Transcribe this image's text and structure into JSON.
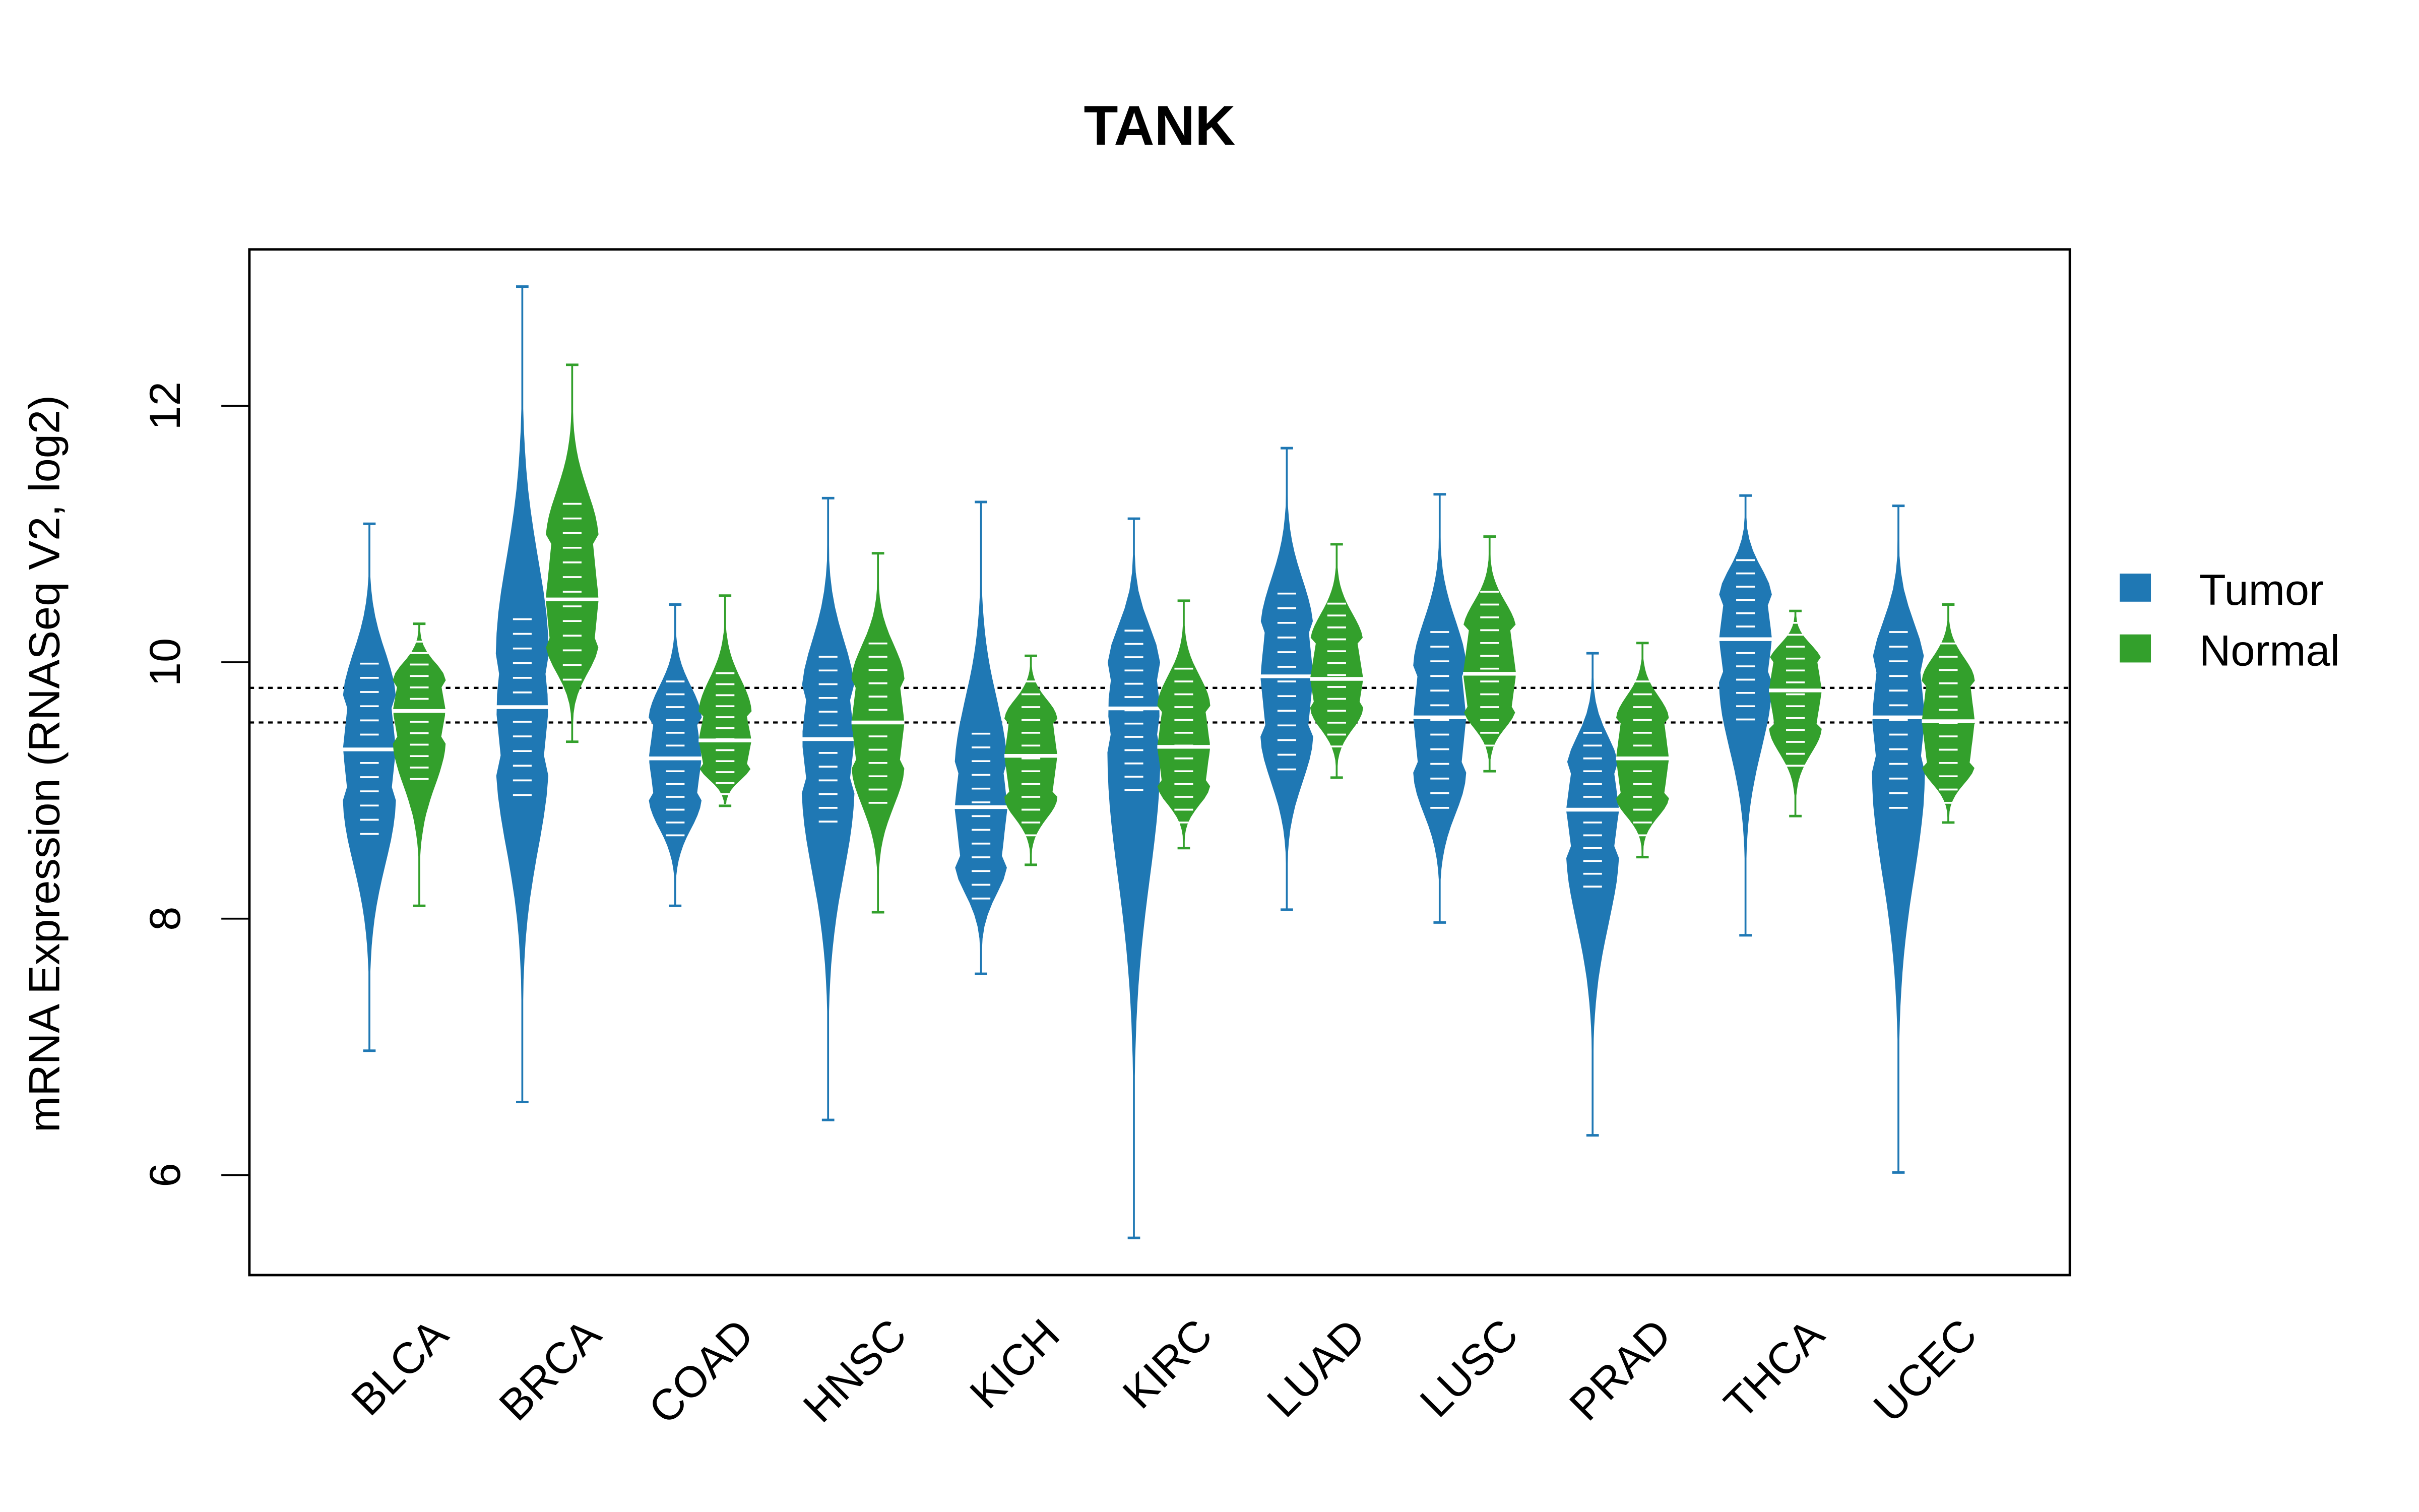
{
  "chart_data": {
    "type": "violin",
    "title": "TANK",
    "xlabel": "",
    "ylabel": "mRNA Expression (RNASeq V2, log2)",
    "ylim": [
      5.22,
      13.22
    ],
    "yticks": [
      6,
      8,
      10,
      12
    ],
    "ytick_labels": [
      "6",
      "8",
      "10",
      "12"
    ],
    "categories": [
      "BLCA",
      "BRCA",
      "COAD",
      "HNSC",
      "KICH",
      "KIRC",
      "LUAD",
      "LUSC",
      "PRAD",
      "THCA",
      "UCEC"
    ],
    "reference_lines": [
      {
        "y": 9.8,
        "style": "dotted"
      },
      {
        "y": 9.53,
        "style": "dotted"
      }
    ],
    "legend": {
      "placement": "right",
      "entries": [
        {
          "label": "Tumor",
          "color": "#1F78B4"
        },
        {
          "label": "Normal",
          "color": "#33A02C"
        }
      ]
    },
    "series": [
      {
        "name": "Tumor",
        "color": "#1F78B4",
        "median": [
          9.32,
          9.65,
          9.25,
          9.4,
          8.87,
          9.64,
          9.89,
          9.57,
          8.85,
          10.18,
          9.57
        ],
        "q1": [
          8.95,
          9.25,
          8.95,
          9.05,
          8.45,
          9.3,
          9.45,
          9.15,
          8.55,
          9.85,
          9.15
        ],
        "q3": [
          9.7,
          10.05,
          9.55,
          9.75,
          9.15,
          9.95,
          10.25,
          9.95,
          9.15,
          10.5,
          9.95
        ],
        "min": [
          6.97,
          6.57,
          8.1,
          6.43,
          7.57,
          5.51,
          8.07,
          7.97,
          6.31,
          7.87,
          6.02
        ],
        "max": [
          11.08,
          12.93,
          10.45,
          11.28,
          11.25,
          11.12,
          11.67,
          11.31,
          10.07,
          11.3,
          11.22
        ]
      },
      {
        "name": "Normal",
        "color": "#33A02C",
        "median": [
          9.62,
          10.49,
          9.39,
          9.53,
          9.27,
          9.34,
          9.87,
          9.91,
          9.25,
          9.78,
          9.54
        ],
        "q1": [
          9.4,
          10.15,
          9.2,
          9.2,
          8.95,
          9.05,
          9.65,
          9.65,
          8.95,
          9.5,
          9.2
        ],
        "q3": [
          9.85,
          10.95,
          9.6,
          9.85,
          9.55,
          9.65,
          10.15,
          10.25,
          9.55,
          10.0,
          9.85
        ],
        "min": [
          8.1,
          9.38,
          8.88,
          8.05,
          8.42,
          8.55,
          9.1,
          9.15,
          8.48,
          8.8,
          8.75
        ],
        "max": [
          10.3,
          12.32,
          10.52,
          10.85,
          10.05,
          10.48,
          10.92,
          10.98,
          10.15,
          10.4,
          10.45
        ]
      }
    ]
  }
}
